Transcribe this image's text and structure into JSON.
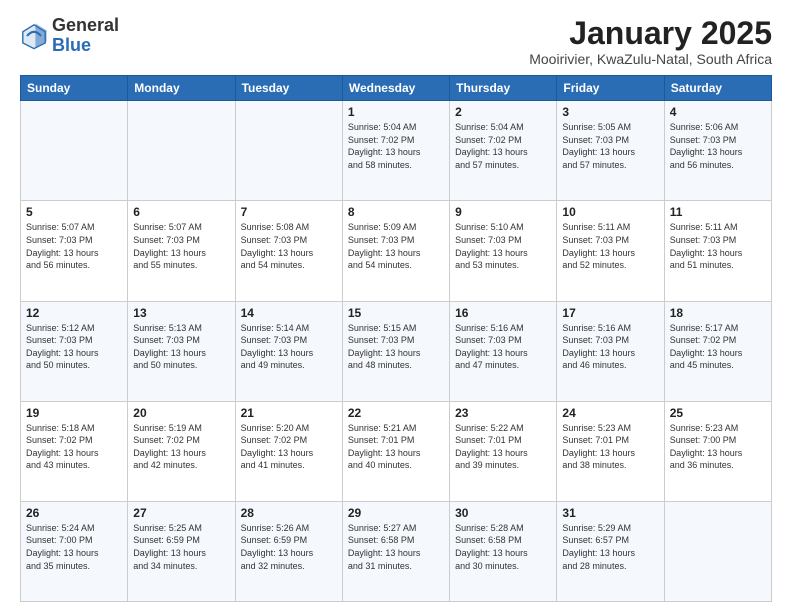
{
  "logo": {
    "general": "General",
    "blue": "Blue"
  },
  "header": {
    "month_title": "January 2025",
    "subtitle": "Mooirivier, KwaZulu-Natal, South Africa"
  },
  "days_of_week": [
    "Sunday",
    "Monday",
    "Tuesday",
    "Wednesday",
    "Thursday",
    "Friday",
    "Saturday"
  ],
  "weeks": [
    [
      {
        "day": "",
        "info": ""
      },
      {
        "day": "",
        "info": ""
      },
      {
        "day": "",
        "info": ""
      },
      {
        "day": "1",
        "info": "Sunrise: 5:04 AM\nSunset: 7:02 PM\nDaylight: 13 hours\nand 58 minutes."
      },
      {
        "day": "2",
        "info": "Sunrise: 5:04 AM\nSunset: 7:02 PM\nDaylight: 13 hours\nand 57 minutes."
      },
      {
        "day": "3",
        "info": "Sunrise: 5:05 AM\nSunset: 7:03 PM\nDaylight: 13 hours\nand 57 minutes."
      },
      {
        "day": "4",
        "info": "Sunrise: 5:06 AM\nSunset: 7:03 PM\nDaylight: 13 hours\nand 56 minutes."
      }
    ],
    [
      {
        "day": "5",
        "info": "Sunrise: 5:07 AM\nSunset: 7:03 PM\nDaylight: 13 hours\nand 56 minutes."
      },
      {
        "day": "6",
        "info": "Sunrise: 5:07 AM\nSunset: 7:03 PM\nDaylight: 13 hours\nand 55 minutes."
      },
      {
        "day": "7",
        "info": "Sunrise: 5:08 AM\nSunset: 7:03 PM\nDaylight: 13 hours\nand 54 minutes."
      },
      {
        "day": "8",
        "info": "Sunrise: 5:09 AM\nSunset: 7:03 PM\nDaylight: 13 hours\nand 54 minutes."
      },
      {
        "day": "9",
        "info": "Sunrise: 5:10 AM\nSunset: 7:03 PM\nDaylight: 13 hours\nand 53 minutes."
      },
      {
        "day": "10",
        "info": "Sunrise: 5:11 AM\nSunset: 7:03 PM\nDaylight: 13 hours\nand 52 minutes."
      },
      {
        "day": "11",
        "info": "Sunrise: 5:11 AM\nSunset: 7:03 PM\nDaylight: 13 hours\nand 51 minutes."
      }
    ],
    [
      {
        "day": "12",
        "info": "Sunrise: 5:12 AM\nSunset: 7:03 PM\nDaylight: 13 hours\nand 50 minutes."
      },
      {
        "day": "13",
        "info": "Sunrise: 5:13 AM\nSunset: 7:03 PM\nDaylight: 13 hours\nand 50 minutes."
      },
      {
        "day": "14",
        "info": "Sunrise: 5:14 AM\nSunset: 7:03 PM\nDaylight: 13 hours\nand 49 minutes."
      },
      {
        "day": "15",
        "info": "Sunrise: 5:15 AM\nSunset: 7:03 PM\nDaylight: 13 hours\nand 48 minutes."
      },
      {
        "day": "16",
        "info": "Sunrise: 5:16 AM\nSunset: 7:03 PM\nDaylight: 13 hours\nand 47 minutes."
      },
      {
        "day": "17",
        "info": "Sunrise: 5:16 AM\nSunset: 7:03 PM\nDaylight: 13 hours\nand 46 minutes."
      },
      {
        "day": "18",
        "info": "Sunrise: 5:17 AM\nSunset: 7:02 PM\nDaylight: 13 hours\nand 45 minutes."
      }
    ],
    [
      {
        "day": "19",
        "info": "Sunrise: 5:18 AM\nSunset: 7:02 PM\nDaylight: 13 hours\nand 43 minutes."
      },
      {
        "day": "20",
        "info": "Sunrise: 5:19 AM\nSunset: 7:02 PM\nDaylight: 13 hours\nand 42 minutes."
      },
      {
        "day": "21",
        "info": "Sunrise: 5:20 AM\nSunset: 7:02 PM\nDaylight: 13 hours\nand 41 minutes."
      },
      {
        "day": "22",
        "info": "Sunrise: 5:21 AM\nSunset: 7:01 PM\nDaylight: 13 hours\nand 40 minutes."
      },
      {
        "day": "23",
        "info": "Sunrise: 5:22 AM\nSunset: 7:01 PM\nDaylight: 13 hours\nand 39 minutes."
      },
      {
        "day": "24",
        "info": "Sunrise: 5:23 AM\nSunset: 7:01 PM\nDaylight: 13 hours\nand 38 minutes."
      },
      {
        "day": "25",
        "info": "Sunrise: 5:23 AM\nSunset: 7:00 PM\nDaylight: 13 hours\nand 36 minutes."
      }
    ],
    [
      {
        "day": "26",
        "info": "Sunrise: 5:24 AM\nSunset: 7:00 PM\nDaylight: 13 hours\nand 35 minutes."
      },
      {
        "day": "27",
        "info": "Sunrise: 5:25 AM\nSunset: 6:59 PM\nDaylight: 13 hours\nand 34 minutes."
      },
      {
        "day": "28",
        "info": "Sunrise: 5:26 AM\nSunset: 6:59 PM\nDaylight: 13 hours\nand 32 minutes."
      },
      {
        "day": "29",
        "info": "Sunrise: 5:27 AM\nSunset: 6:58 PM\nDaylight: 13 hours\nand 31 minutes."
      },
      {
        "day": "30",
        "info": "Sunrise: 5:28 AM\nSunset: 6:58 PM\nDaylight: 13 hours\nand 30 minutes."
      },
      {
        "day": "31",
        "info": "Sunrise: 5:29 AM\nSunset: 6:57 PM\nDaylight: 13 hours\nand 28 minutes."
      },
      {
        "day": "",
        "info": ""
      }
    ]
  ]
}
